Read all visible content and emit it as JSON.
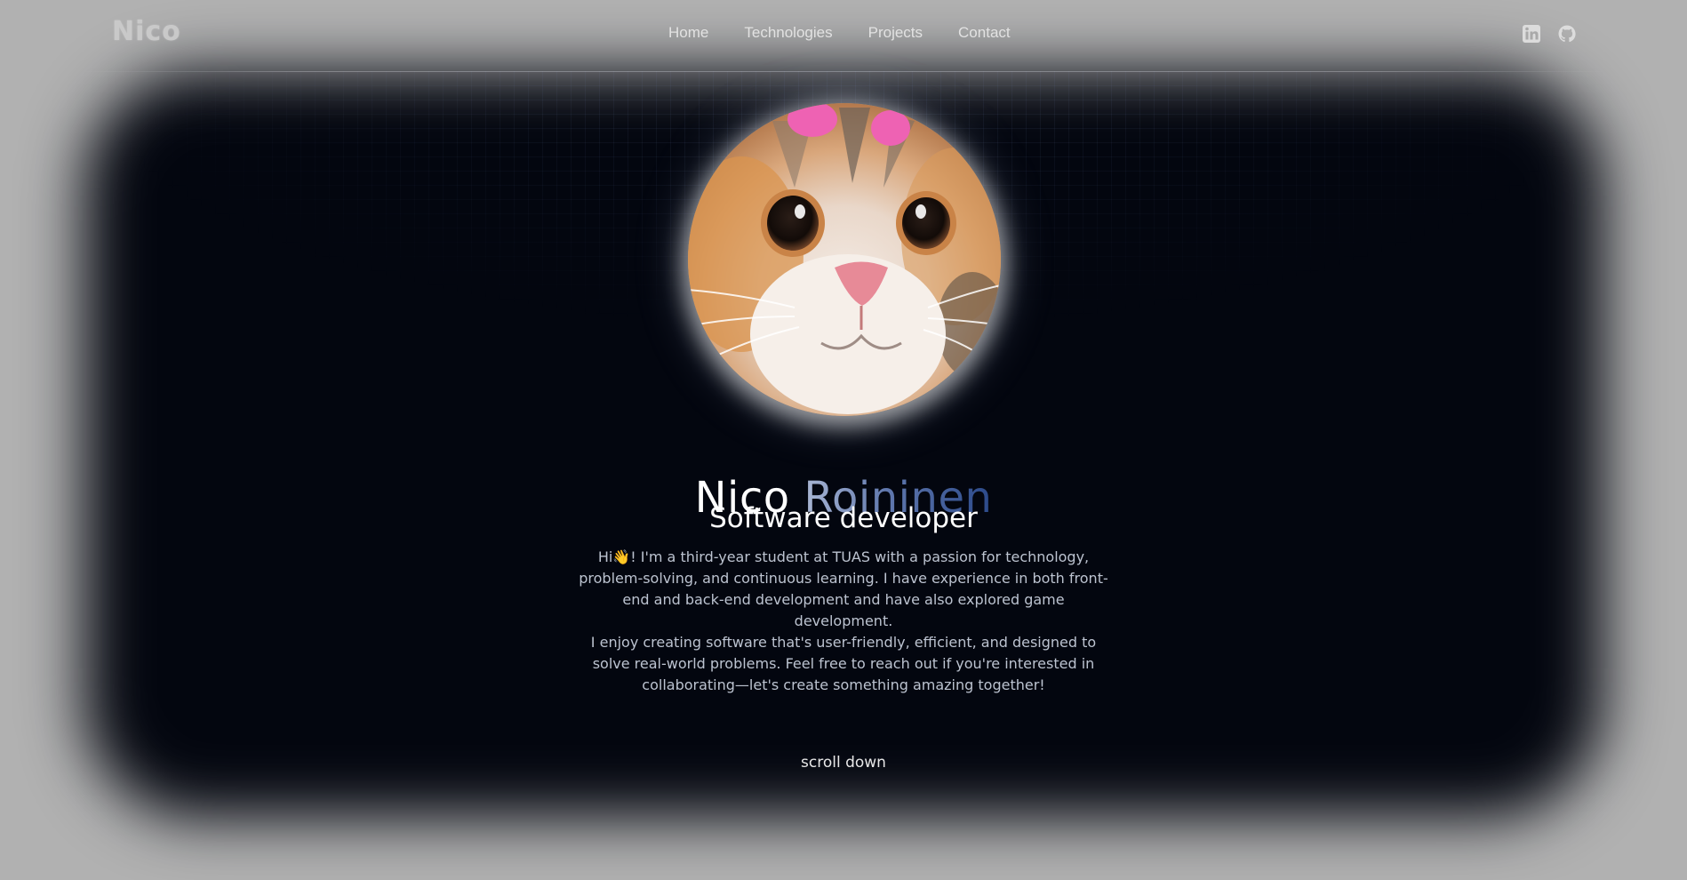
{
  "nav": {
    "logo": "Nico",
    "links": [
      "Home",
      "Technologies",
      "Projects",
      "Contact"
    ],
    "social": [
      {
        "icon": "linkedin-icon",
        "label": "in"
      },
      {
        "icon": "github-icon"
      }
    ]
  },
  "hero": {
    "avatar_alt": "cat-photo",
    "first_name": "Nico",
    "last_name": "Roininen",
    "role": "Software developer",
    "bio_1": "Hi👋! I'm a third-year student at TUAS with a passion for technology, problem-solving, and continuous learning. I have experience in both front-end and back-end development and have also explored game development.",
    "bio_2": "I enjoy creating software that's user-friendly, efficient, and designed to solve real-world problems. Feel free to reach out if you're interested in collaborating—let's create something amazing together!",
    "scroll_label": "scroll down"
  },
  "colors": {
    "backdrop": "#b1b1b1",
    "hero": "#03060f",
    "name_gradient": [
      "#aab7d4",
      "#2c4a8a"
    ],
    "text": "#ffffff",
    "bio_text": "#bcc3d0"
  }
}
